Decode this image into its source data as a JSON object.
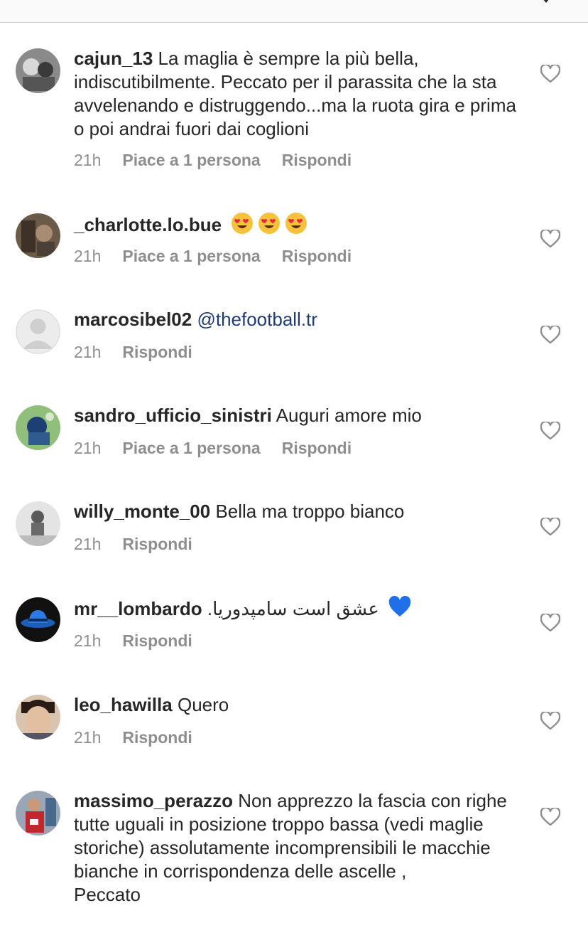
{
  "comments": [
    {
      "user": "cajun_13",
      "text": "La maglia è sempre la più bella, indiscutibilmente. Peccato per il parassita che la sta avvelenando e distruggendo...ma la ruota gira e prima o poi andrai fuori dai coglioni",
      "time": "21h",
      "likes": "Piace a 1 persona",
      "reply": "Rispondi"
    },
    {
      "user": "_charlotte.lo.bue",
      "text": "",
      "time": "21h",
      "likes": "Piace a 1 persona",
      "reply": "Rispondi"
    },
    {
      "user": "marcosibel02",
      "text": "@thefootball.tr",
      "time": "21h",
      "reply": "Rispondi"
    },
    {
      "user": "sandro_ufficio_sinistri",
      "text": "Auguri amore mio",
      "time": "21h",
      "likes": "Piace a 1 persona",
      "reply": "Rispondi"
    },
    {
      "user": "willy_monte_00",
      "text": "Bella ma troppo bianco",
      "time": "21h",
      "reply": "Rispondi"
    },
    {
      "user": "mr__lombardo",
      "text": "عشق است سامپدوریا.",
      "time": "21h",
      "reply": "Rispondi"
    },
    {
      "user": "leo_hawilla",
      "text": "Quero",
      "time": "21h",
      "reply": "Rispondi"
    },
    {
      "user": "massimo_perazzo",
      "text": "Non apprezzo la fascia con righe tutte uguali in posizione troppo bassa (vedi maglie storiche) assolutamente incomprensibili le macchie bianche in corrispondenza delle ascelle ,",
      "text2": "Peccato"
    }
  ],
  "icons": {
    "like": "heart-outline-icon",
    "heart_eyes": "heart-eyes-emoji",
    "blue_heart": "blue-heart-emoji"
  },
  "colors": {
    "text": "#262626",
    "secondary": "#8e8e8e",
    "mention": "#1f3a74"
  }
}
